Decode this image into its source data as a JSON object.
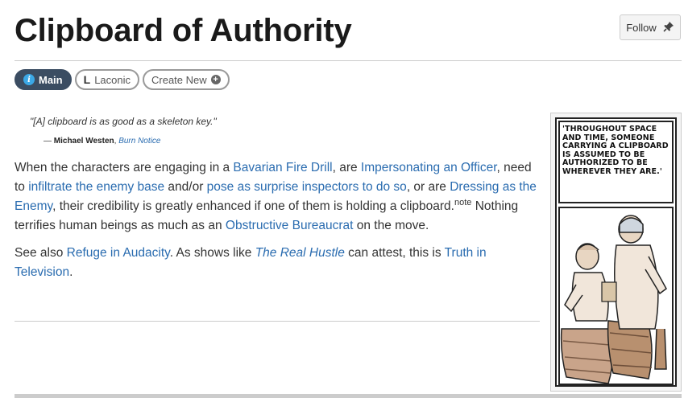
{
  "page": {
    "title": "Clipboard of Authority",
    "follow_label": "Follow"
  },
  "tabs": [
    {
      "label": "Main",
      "active": true,
      "icon": "info-icon"
    },
    {
      "label": "Laconic",
      "active": false,
      "icon": "laconic-icon"
    },
    {
      "label": "Create New",
      "active": false,
      "icon": "plus-circle-icon"
    }
  ],
  "quote": {
    "text": "\"[A] clipboard is as good as a skeleton key.\"",
    "dash": "— ",
    "author": "Michael Westen",
    "separator": ", ",
    "source": "Burn Notice"
  },
  "body": {
    "p1": {
      "t1": "When the characters are engaging in a ",
      "l1": "Bavarian Fire Drill",
      "t2": ", are ",
      "l2": "Impersonating an Officer",
      "t3": ", need to ",
      "l3": "infiltrate the enemy base",
      "t4": " and/or ",
      "l4": "pose as surprise inspectors to do so",
      "t5": ", or are ",
      "l5": "Dressing as the Enemy",
      "t6": ", their credibility is greatly enhanced if one of them is holding a clipboard.",
      "note": "note",
      "t7": "  Nothing terrifies human beings as much as an ",
      "l6": "Obstructive Bureaucrat",
      "t8": " on the move."
    },
    "p2": {
      "t1": "See also ",
      "l1": "Refuge in Audacity",
      "t2": ". As shows like ",
      "l2": "The Real Hustle",
      "t3": " can attest, this is ",
      "l3": "Truth in Television",
      "t4": "."
    }
  },
  "image": {
    "caption": "'THROUGHOUT SPACE AND TIME, SOMEONE CARRYING A CLIPBOARD IS ASSUMED TO BE AUTHORIZED TO BE WHEREVER THEY ARE.'"
  },
  "colors": {
    "link": "#2a6cb0",
    "tab_active_bg": "#3b4d62",
    "info_icon": "#3ba8e6"
  }
}
